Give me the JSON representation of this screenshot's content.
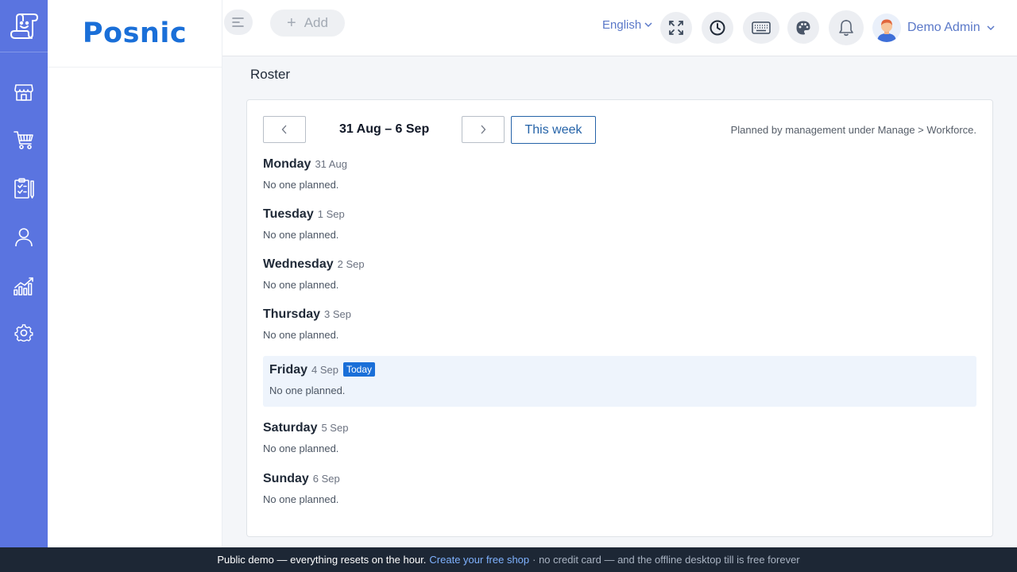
{
  "brand": {
    "name": "Posnic"
  },
  "sidebar": {
    "items": [
      {
        "icon": "store-icon"
      },
      {
        "icon": "cart-icon"
      },
      {
        "icon": "clipboard-icon"
      },
      {
        "icon": "user-icon"
      },
      {
        "icon": "chart-icon"
      },
      {
        "icon": "gear-icon"
      }
    ]
  },
  "topbar": {
    "add_label": "Add",
    "language": "English",
    "user_name": "Demo Admin"
  },
  "page": {
    "title": "Roster"
  },
  "roster": {
    "range": "31 Aug – 6 Sep",
    "this_week_label": "This week",
    "hint": "Planned by management under Manage > Workforce.",
    "empty_text": "No one planned.",
    "today_badge": "Today",
    "days": [
      {
        "name": "Monday",
        "date": "31 Aug",
        "status": "No one planned."
      },
      {
        "name": "Tuesday",
        "date": "1 Sep",
        "status": "No one planned."
      },
      {
        "name": "Wednesday",
        "date": "2 Sep",
        "status": "No one planned."
      },
      {
        "name": "Thursday",
        "date": "3 Sep",
        "status": "No one planned."
      },
      {
        "name": "Friday",
        "date": "4 Sep",
        "status": "No one planned."
      },
      {
        "name": "Saturday",
        "date": "5 Sep",
        "status": "No one planned."
      },
      {
        "name": "Sunday",
        "date": "6 Sep",
        "status": "No one planned."
      }
    ]
  },
  "footer": {
    "text": "Public demo — everything resets on the hour.",
    "link": "Create your free shop",
    "suffix": "· no credit card — and the offline desktop till is free forever"
  },
  "colors": {
    "rail": "#5a74e0",
    "brand": "#1a6fd8",
    "accent": "#2563a8",
    "today_bg": "#eef4fc",
    "footer_bg": "#1d2735",
    "footer_link": "#7fb2ff"
  }
}
